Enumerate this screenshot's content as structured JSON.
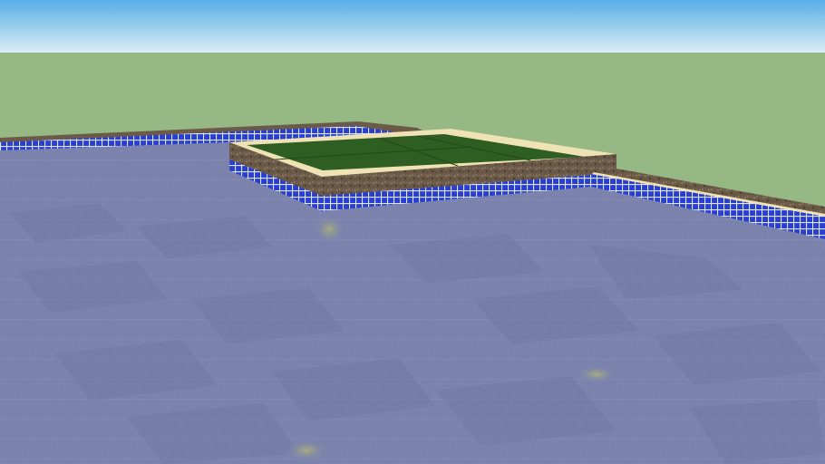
{
  "viewport": {
    "kind": "3d-model-view",
    "scene_label": "",
    "colors": {
      "sky_top": "#5aaee6",
      "sky_bottom": "#d8ecf6",
      "ground": "#95b884",
      "water_surface": "#7b83ad",
      "water_dark": "#6e769f",
      "pool_tile": "#2a3fd0",
      "tile_grout": "#dfe6ff",
      "stone_coping": "#6b5a48",
      "sand_edge": "#efe2b5",
      "grass_platform": "#2e5e22",
      "light_spot": "#a8ad7c"
    }
  }
}
